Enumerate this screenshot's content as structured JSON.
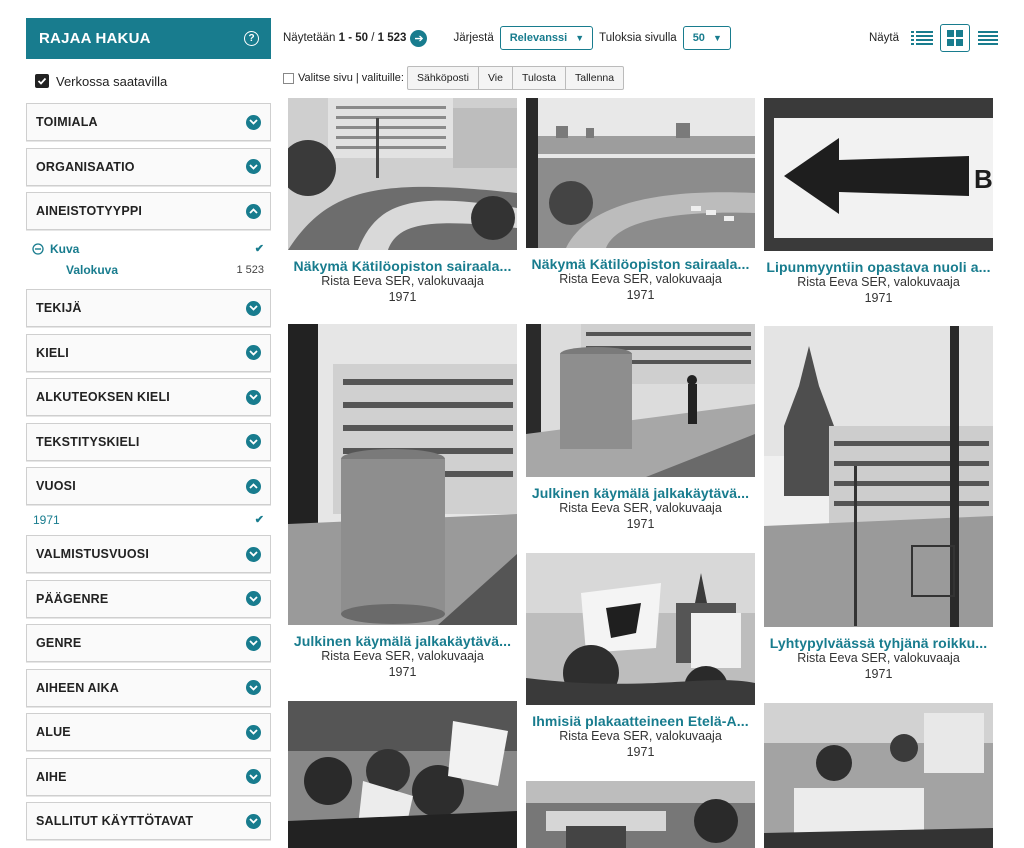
{
  "sidebar": {
    "header": "RAJAA HAKUA",
    "online_label": "Verkossa saatavilla",
    "facets_top": [
      "TOIMIALA",
      "ORGANISAATIO",
      "AINEISTOTYYPPI"
    ],
    "type_filter": {
      "label": "Kuva",
      "sub_label": "Valokuva",
      "sub_count": "1 523"
    },
    "facets_mid": [
      "TEKIJÄ",
      "KIELI",
      "ALKUTEOKSEN KIELI",
      "TEKSTITYSKIELI",
      "VUOSI"
    ],
    "year_filter": "1971",
    "facets_bottom": [
      "VALMISTUSVUOSI",
      "PÄÄGENRE",
      "GENRE",
      "AIHEEN AIKA",
      "ALUE",
      "AIHE",
      "SALLITUT KÄYTTÖTAVAT"
    ]
  },
  "topbar": {
    "showing_prefix": "Näytetään",
    "range": "1 - 50",
    "separator": "/",
    "total": "1 523",
    "sort_label": "Järjestä",
    "sort_value": "Relevanssi",
    "per_page_label": "Tuloksia sivulla",
    "per_page_value": "50",
    "view_label": "Näytä"
  },
  "toolbar": {
    "select_label": "Valitse sivu | valituille:",
    "buttons": [
      "Sähköposti",
      "Vie",
      "Tulosta",
      "Tallenna"
    ]
  },
  "results": [
    {
      "title": "Näkymä Kätilöopiston sairaala...",
      "author": "Rista Eeva SER, valokuvaaja",
      "year": "1971"
    },
    {
      "title": "Näkymä Kätilöopiston sairaala...",
      "author": "Rista Eeva SER, valokuvaaja",
      "year": "1971"
    },
    {
      "title": "Lipunmyyntiin opastava nuoli a...",
      "author": "Rista Eeva SER, valokuvaaja",
      "year": "1971"
    },
    {
      "title": "Julkinen käymälä jalkakäytävä...",
      "author": "Rista Eeva SER, valokuvaaja",
      "year": "1971"
    },
    {
      "title": "Julkinen käymälä jalkakäytävä...",
      "author": "Rista Eeva SER, valokuvaaja",
      "year": "1971"
    },
    {
      "title": "Lyhtypylväässä tyhjänä roikku...",
      "author": "Rista Eeva SER, valokuvaaja",
      "year": "1971"
    },
    {
      "title": "Ihmisiä plakaatteineen Etelä-A...",
      "author": "Rista Eeva SER, valokuvaaja",
      "year": "1971"
    }
  ],
  "colors": {
    "accent": "#187c8e"
  }
}
